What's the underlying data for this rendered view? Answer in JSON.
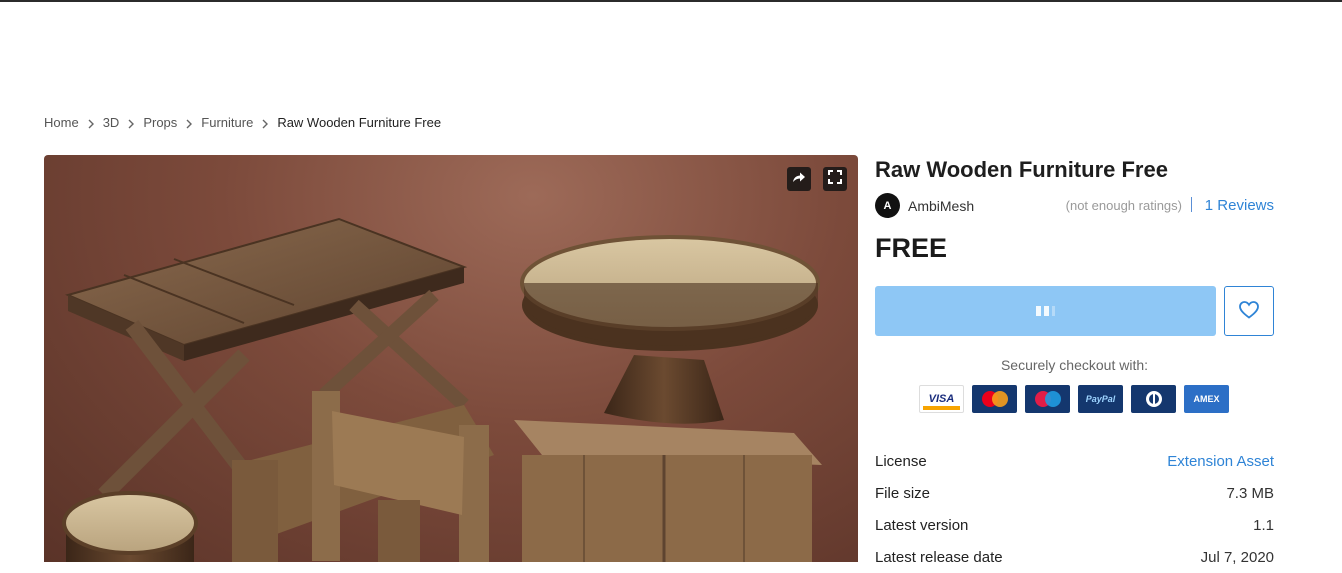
{
  "breadcrumb": [
    {
      "label": "Home"
    },
    {
      "label": "3D"
    },
    {
      "label": "Props"
    },
    {
      "label": "Furniture"
    },
    {
      "label": "Raw Wooden Furniture Free"
    }
  ],
  "product": {
    "title": "Raw Wooden Furniture Free",
    "publisher_initial": "A",
    "publisher": "AmbiMesh",
    "ratings_text": "(not enough ratings)",
    "reviews_text": "1 Reviews",
    "price": "FREE"
  },
  "checkout": {
    "label": "Securely checkout with:",
    "methods": [
      {
        "name": "VISA"
      },
      {
        "name": "Mastercard"
      },
      {
        "name": "Maestro"
      },
      {
        "name": "PayPal"
      },
      {
        "name": "Diners Club"
      },
      {
        "name": "AMEX"
      }
    ]
  },
  "details": [
    {
      "key": "License",
      "value": "Extension Asset",
      "link": true
    },
    {
      "key": "File size",
      "value": "7.3 MB",
      "link": false
    },
    {
      "key": "Latest version",
      "value": "1.1",
      "link": false
    },
    {
      "key": "Latest release date",
      "value": "Jul 7, 2020",
      "link": false
    }
  ],
  "colors": {
    "accent": "#2f84d6",
    "buy_button_loading": "#8ec7f5",
    "hero_background": "#7c4a3b"
  },
  "icons": {
    "share": "share-icon",
    "fullscreen": "fullscreen-icon",
    "favorite": "heart-icon",
    "separator": "chevron-right-icon"
  }
}
